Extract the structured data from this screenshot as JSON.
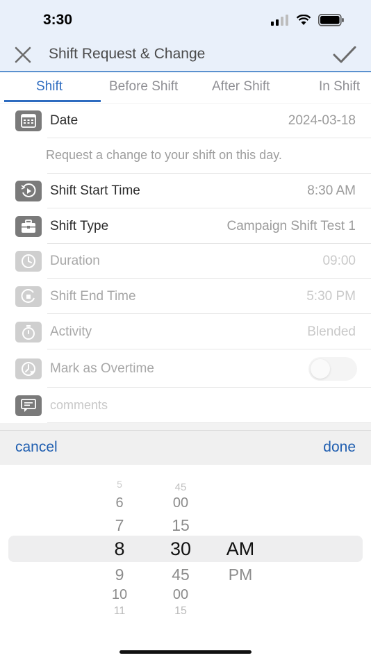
{
  "status_bar": {
    "time": "3:30"
  },
  "nav": {
    "title": "Shift Request & Change"
  },
  "tabs": [
    {
      "label": "Shift",
      "active": true
    },
    {
      "label": "Before Shift",
      "active": false
    },
    {
      "label": "After Shift",
      "active": false
    },
    {
      "label": "In Shift",
      "active": false
    }
  ],
  "rows": {
    "date": {
      "label": "Date",
      "value": "2024-03-18",
      "icon": "calendar-icon"
    },
    "note": "Request a change to your shift on this day.",
    "start": {
      "label": "Shift Start Time",
      "value": "8:30 AM",
      "icon": "play-clock-icon"
    },
    "type": {
      "label": "Shift Type",
      "value": "Campaign Shift Test 1",
      "icon": "briefcase-icon"
    },
    "duration": {
      "label": "Duration",
      "value": "09:00",
      "icon": "clock-icon"
    },
    "end": {
      "label": "Shift End Time",
      "value": "5:30 PM",
      "icon": "end-clock-icon"
    },
    "activity": {
      "label": "Activity",
      "value": "Blended",
      "icon": "stopwatch-icon"
    },
    "overtime": {
      "label": "Mark as Overtime",
      "icon": "overtime-clock-icon",
      "toggle_on": false
    },
    "comments": {
      "placeholder": "comments",
      "icon": "comment-icon"
    }
  },
  "picker": {
    "cancel_label": "cancel",
    "done_label": "done",
    "hours": [
      "5",
      "6",
      "7",
      "8",
      "9",
      "10",
      "11"
    ],
    "minutes": [
      "45",
      "00",
      "15",
      "30",
      "45",
      "00",
      "15"
    ],
    "ampm": [
      "AM",
      "PM"
    ],
    "selected": {
      "hour": "8",
      "minute": "30",
      "ampm": "AM"
    }
  },
  "colors": {
    "accent": "#2e6cc0",
    "header_bg": "#e9f0fa"
  }
}
